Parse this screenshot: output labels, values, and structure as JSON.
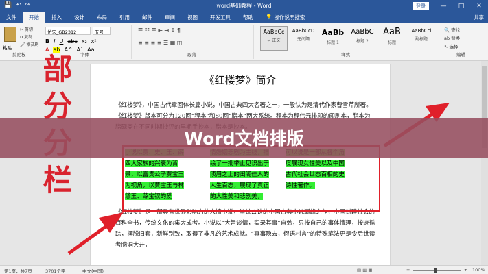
{
  "window": {
    "title": "word基础教程 - Word",
    "login": "登录",
    "min_icon": "—",
    "max_icon": "□",
    "close_icon": "✕"
  },
  "quick_access": {
    "save_icon": "💾",
    "undo_icon": "↶",
    "redo_icon": "↷"
  },
  "tabs": [
    "文件",
    "开始",
    "插入",
    "设计",
    "布局",
    "引用",
    "邮件",
    "审阅",
    "视图",
    "开发工具",
    "帮助"
  ],
  "tell_me": {
    "icon": "💡",
    "label": "操作说明搜索"
  },
  "share_label": "共享",
  "ribbon": {
    "clipboard": {
      "paste_label": "粘贴",
      "cut": "✂ 剪切",
      "copy": "⧉ 复制",
      "painter": "🖌 格式刷",
      "group_label": "剪贴板"
    },
    "font": {
      "font_name": "仿宋_GB2312",
      "font_size": "五号",
      "bold": "B",
      "italic": "I",
      "underline": "U",
      "strike": "abc",
      "sub": "x₂",
      "sup": "x²",
      "font_color": "A",
      "highlight": "ab",
      "grow": "A^",
      "shrink": "Aˇ",
      "case": "Aa",
      "group_label": "字体"
    },
    "paragraph": {
      "row1": "☰  ☷  ☰  ⇤  ⇥  ↕  ¶",
      "row2": "≡  ≡  ≡  ≡  ☰  ▦  ◫",
      "group_label": "段落"
    },
    "styles": {
      "items": [
        {
          "sample": "AaBbCc",
          "name": "↵ 正文"
        },
        {
          "sample": "AaBbCcD",
          "name": "无间隔"
        },
        {
          "sample": "AaBb",
          "name": "标题 1"
        },
        {
          "sample": "AaBbC",
          "name": "标题 2"
        },
        {
          "sample": "AaB",
          "name": "标题"
        },
        {
          "sample": "AaBbCcl",
          "name": "副标题"
        }
      ],
      "group_label": "样式"
    },
    "editing": {
      "find": "🔍 查找",
      "replace": "ab 替换",
      "select": "↖ 选择",
      "group_label": "编辑"
    }
  },
  "document": {
    "heading": "《红楼梦》简介",
    "para1": "《红楼梦》，中国古代章回体长篇小说，中国古典四大名著之一，一般认为是清代作家曹雪芹所著。《红楼梦》版本可分为120回“程本”和80回“脂本”两大系统。程本为程伟元排印的印刷本，脂本为脂砚斋在不同时期抄评的早期手抄本，脂本是抄本。",
    "columns": [
      "小说以贾、史、王、薛四大家族的兴衰为背景，以富贵公子贾宝玉为视角，以贾宝玉与林黛玉、薛宝钗的爱",
      "情婚姻悲剧为主线，描绘了一批举止见识出于须眉之上的闺阁佳人的人生百态，展现了真正的人性美和悲剧美，",
      "可以说是一部从各个角度展现女性美以及中国古代社会世态百相的史诗性著作。"
    ],
    "para2": "《红楼梦》是一部具有世界影响力的人情小说，举世公认的中国古典小说巅峰之作，中国封建社会的百科全书，传统文化的集大成者。小说以“大旨谈情，实录其事”自勉，只按自己的事体情理，按迹循踪，摆脱旧套，新鲜别致，取得了非凡的艺术成就。“真事隐去，假语村言”的特殊笔法更是令后世读者脑洞大开，"
  },
  "annotation": {
    "big_text": "部分分栏",
    "color": "#d9232e"
  },
  "banner": {
    "text": "Word文档排版"
  },
  "status": {
    "page": "第1页，共7页",
    "words": "3701个字",
    "lang": "中文(中国)",
    "view_icons": "▤  ▥  ▦",
    "zoom_minus": "−",
    "zoom_plus": "+",
    "zoom_value": "100%"
  },
  "colors": {
    "accent": "#2b579a",
    "highlight": "#33ee33",
    "annotation_red": "#e0202a",
    "banner": "#964e60"
  }
}
